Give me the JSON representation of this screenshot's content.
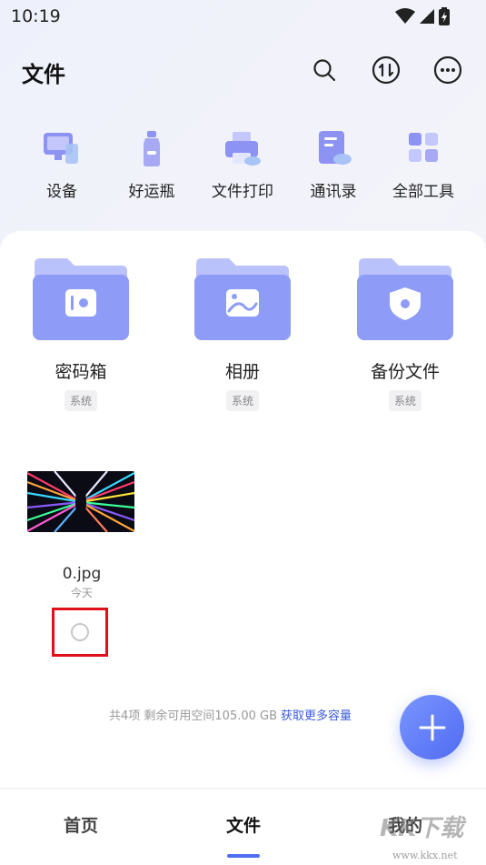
{
  "status_bar": {
    "time": "10:19"
  },
  "header": {
    "title": "文件"
  },
  "tools": [
    {
      "label": "设备",
      "icon": "device-icon"
    },
    {
      "label": "好运瓶",
      "icon": "bottle-icon"
    },
    {
      "label": "文件打印",
      "icon": "printer-icon"
    },
    {
      "label": "通讯录",
      "icon": "contacts-icon"
    },
    {
      "label": "全部工具",
      "icon": "all-tools-icon"
    }
  ],
  "folders": [
    {
      "name": "密码箱",
      "badge": "系统",
      "icon": "safe-icon"
    },
    {
      "name": "相册",
      "badge": "系统",
      "icon": "album-icon"
    },
    {
      "name": "备份文件",
      "badge": "系统",
      "icon": "shield-icon"
    }
  ],
  "file": {
    "name": "0.jpg",
    "date": "今天"
  },
  "storage": {
    "text": "共4项 剩余可用空间105.00 GB",
    "link": "获取更多容量"
  },
  "bottom_nav": [
    {
      "label": "首页"
    },
    {
      "label": "文件"
    },
    {
      "label": "我的"
    }
  ],
  "watermark": {
    "main": "KK下载",
    "sub": "www.kkx.net"
  },
  "colors": {
    "accent": "#4f6cf2",
    "folder": "#8e9cf7",
    "selection_outline": "#e0101a"
  }
}
